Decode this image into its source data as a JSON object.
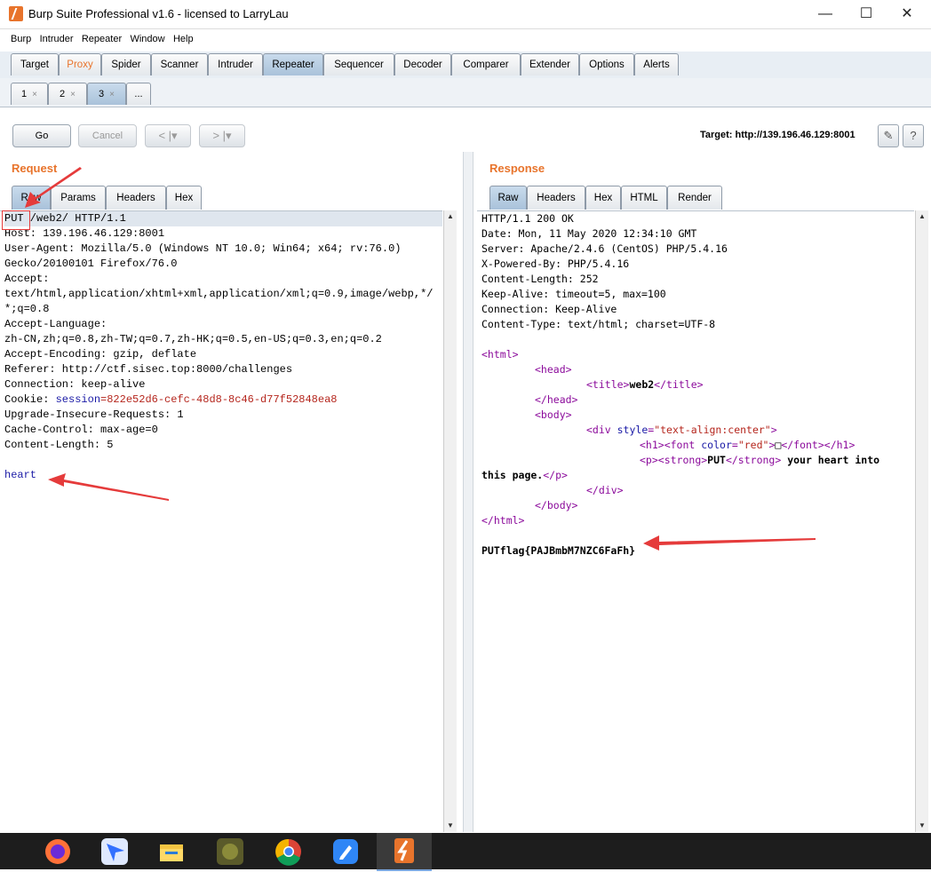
{
  "window": {
    "title": "Burp Suite Professional v1.6 - licensed to LarryLau",
    "minimize": "—",
    "maximize": "☐",
    "close": "✕"
  },
  "menu": [
    "Burp",
    "Intruder",
    "Repeater",
    "Window",
    "Help"
  ],
  "tabs": [
    "Target",
    "Proxy",
    "Spider",
    "Scanner",
    "Intruder",
    "Repeater",
    "Sequencer",
    "Decoder",
    "Comparer",
    "Extender",
    "Options",
    "Alerts"
  ],
  "active_tab": "Repeater",
  "subtabs": [
    {
      "label": "1",
      "close": "×"
    },
    {
      "label": "2",
      "close": "×"
    },
    {
      "label": "3",
      "close": "×"
    },
    {
      "label": "...",
      "close": ""
    }
  ],
  "toolbar": {
    "go": "Go",
    "cancel": "Cancel",
    "back": "< |▾",
    "forward": "> |▾",
    "target": "Target: http://139.196.46.129:8001",
    "edit_icon": "✎",
    "help_icon": "?"
  },
  "request": {
    "heading": "Request",
    "tabs": [
      "Raw",
      "Params",
      "Headers",
      "Hex"
    ],
    "lines": [
      "PUT /web2/ HTTP/1.1",
      "Host: 139.196.46.129:8001",
      "User-Agent: Mozilla/5.0 (Windows NT 10.0; Win64; x64; rv:76.0)",
      "Gecko/20100101 Firefox/76.0",
      "Accept:",
      "text/html,application/xhtml+xml,application/xml;q=0.9,image/webp,*/",
      "*;q=0.8",
      "Accept-Language:",
      "zh-CN,zh;q=0.8,zh-TW;q=0.7,zh-HK;q=0.5,en-US;q=0.3,en;q=0.2",
      "Accept-Encoding: gzip, deflate",
      "Referer: http://ctf.sisec.top:8000/challenges",
      "Connection: keep-alive"
    ],
    "cookie_key": "Cookie: ",
    "cookie_name": "session",
    "cookie_value": "=822e52d6-cefc-48d8-8c46-d77f52848ea8",
    "lines2": [
      "Upgrade-Insecure-Requests: 1",
      "Cache-Control: max-age=0",
      "Content-Length: 5"
    ],
    "body": "heart"
  },
  "response": {
    "heading": "Response",
    "tabs": [
      "Raw",
      "Headers",
      "Hex",
      "HTML",
      "Render"
    ],
    "headers": [
      "HTTP/1.1 200 OK",
      "Date: Mon, 11 May 2020 12:34:10 GMT",
      "Server: Apache/2.4.6 (CentOS) PHP/5.4.16",
      "X-Powered-By: PHP/5.4.16",
      "Content-Length: 252",
      "Keep-Alive: timeout=5, max=100",
      "Connection: Keep-Alive",
      "Content-Type: text/html; charset=UTF-8"
    ],
    "html_lines": {
      "html_open": "<html>",
      "head_open": "<head>",
      "title_open": "<title>",
      "title_text": "web2",
      "title_close": "</title>",
      "head_close": "</head>",
      "body_open": "<body>",
      "div_open_a": "<div ",
      "div_attr": "style",
      "div_eq": "=",
      "div_val": "\"text-align:center\"",
      "div_gt": ">",
      "h1_open": "<h1>",
      "font_open": "<font ",
      "font_attr": "color",
      "font_val": "\"red\"",
      "font_gt": ">",
      "box": "□",
      "font_close": "</font>",
      "h1_close": "</h1>",
      "p_open": "<p>",
      "strong_open": "<strong>",
      "strong_text": "PUT",
      "strong_close": "</strong>",
      "p_text": " your heart into",
      "p_text2": "this page.",
      "p_close": "</p>",
      "div_close": "</div>",
      "body_close": "</body>",
      "html_close": "</html>"
    },
    "flag": "PUTflag{PAJBmbM7NZC6FaFh}"
  },
  "taskbar": [
    "firefox-icon",
    "feishu-icon",
    "file-explorer-icon",
    "app-icon",
    "chrome-icon",
    "notes-icon",
    "burp-icon"
  ]
}
